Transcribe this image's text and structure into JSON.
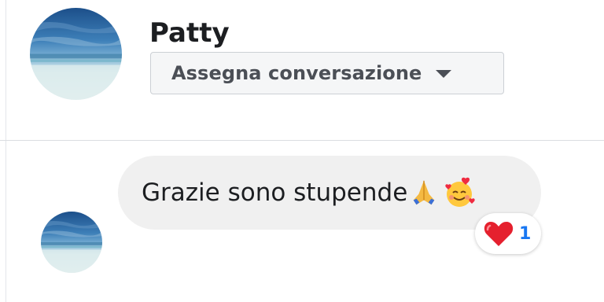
{
  "contact": {
    "name": "Patty"
  },
  "assign": {
    "label": "Assegna conversazione"
  },
  "message": {
    "text": "Grazie sono stupende",
    "emojis": [
      "folded-hands-emoji",
      "smiling-face-with-hearts-emoji"
    ]
  },
  "reaction": {
    "icon": "red-heart-emoji",
    "count": "1"
  },
  "colors": {
    "bubble_bg": "#f0f0f0",
    "accent": "#1877f2",
    "text": "#1c1e21",
    "select_bg": "#f5f6f7"
  }
}
